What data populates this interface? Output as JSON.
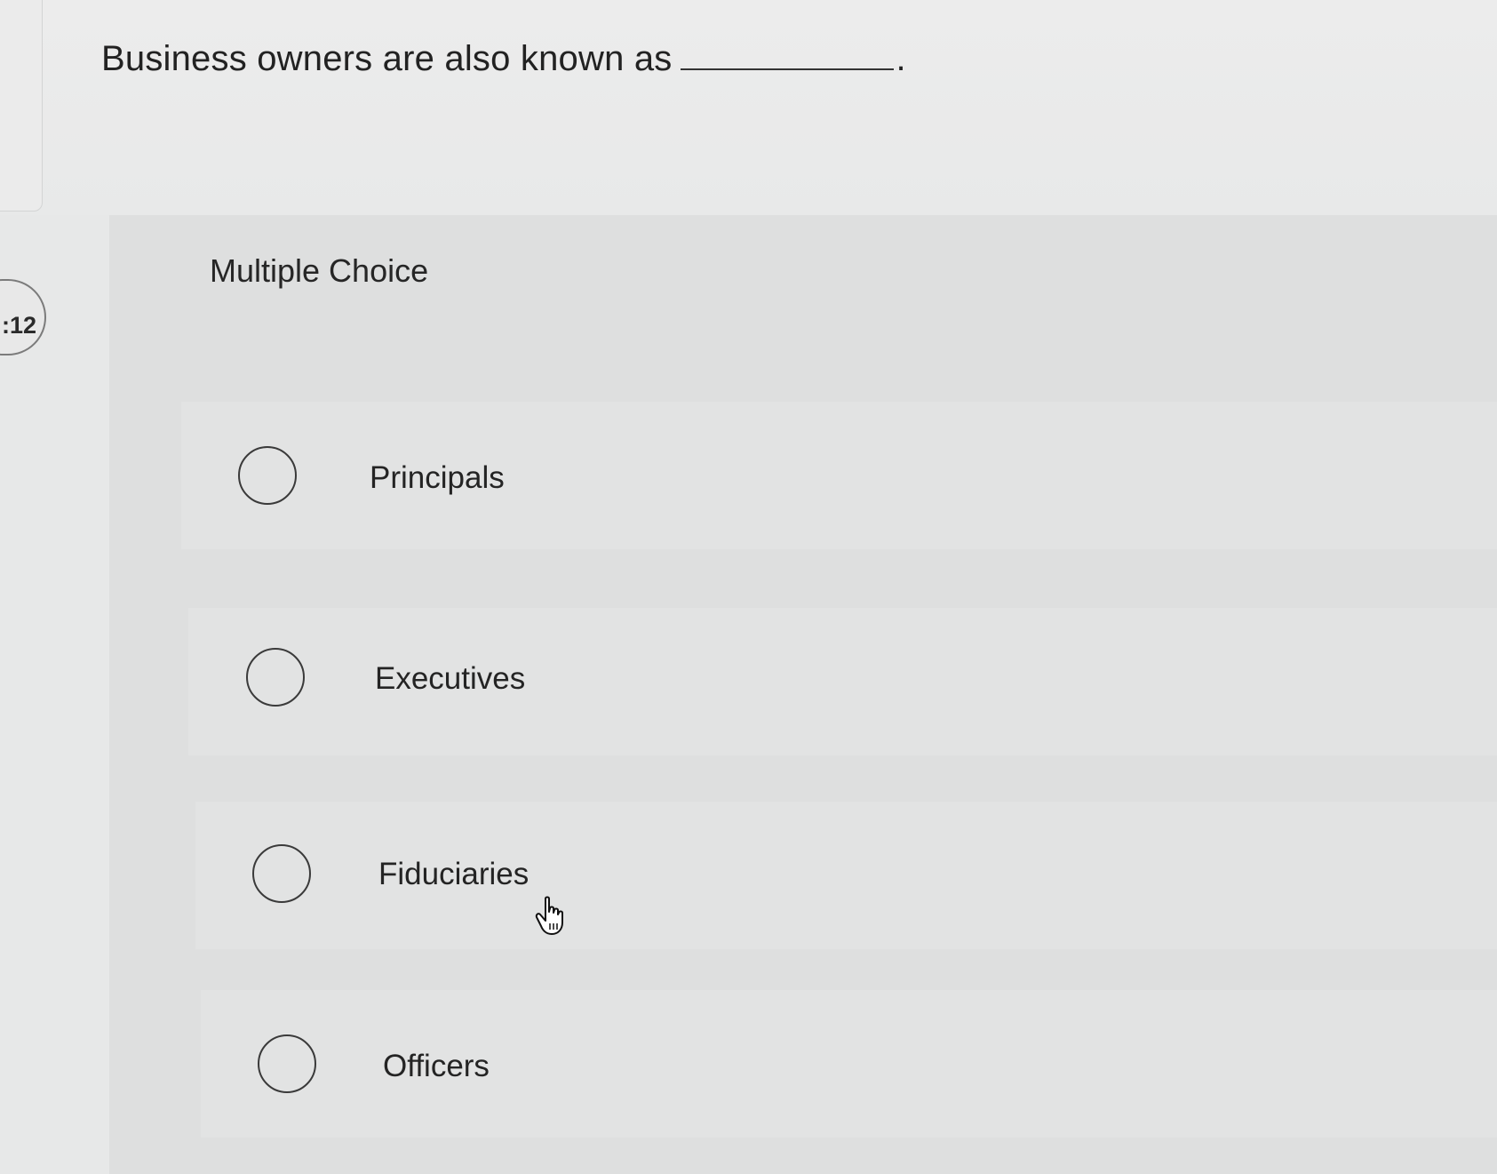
{
  "question": {
    "text": "Business owners are also known as",
    "end_punct": "."
  },
  "timer": {
    "text": ":12"
  },
  "section": {
    "title": "Multiple Choice"
  },
  "options": [
    {
      "label": "Principals",
      "selected": false
    },
    {
      "label": "Executives",
      "selected": false
    },
    {
      "label": "Fiduciaries",
      "selected": false
    },
    {
      "label": "Officers",
      "selected": false
    }
  ],
  "icons": {
    "radio": "radio-unselected-icon",
    "cursor": "hand-pointer-icon"
  }
}
